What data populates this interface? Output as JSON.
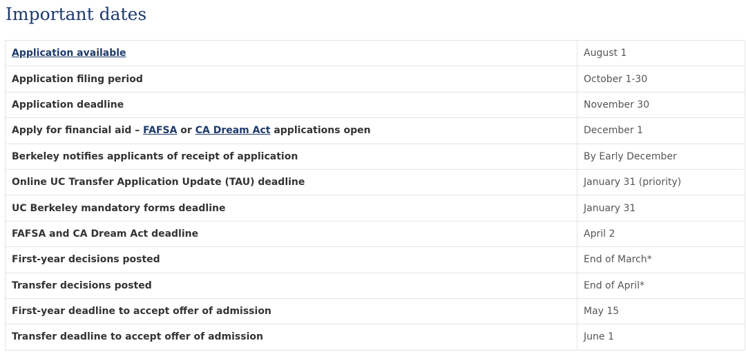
{
  "title": "Important dates",
  "link_color": "#1d3a6b",
  "rows": [
    {
      "parts": [
        {
          "text": "Application available",
          "link": true
        }
      ],
      "date": "August 1"
    },
    {
      "parts": [
        {
          "text": "Application filing period",
          "link": false
        }
      ],
      "date": "October 1-30"
    },
    {
      "parts": [
        {
          "text": "Application deadline",
          "link": false
        }
      ],
      "date": "November 30"
    },
    {
      "parts": [
        {
          "text": "Apply for financial aid – ",
          "link": false
        },
        {
          "text": "FAFSA",
          "link": true
        },
        {
          "text": " or ",
          "link": false
        },
        {
          "text": "CA Dream Act",
          "link": true
        },
        {
          "text": " applications open",
          "link": false
        }
      ],
      "date": "December 1"
    },
    {
      "parts": [
        {
          "text": "Berkeley notifies applicants of receipt of application",
          "link": false
        }
      ],
      "date": "By Early December"
    },
    {
      "parts": [
        {
          "text": "Online UC Transfer Application Update (TAU) deadline",
          "link": false
        }
      ],
      "date": "January 31 (priority)"
    },
    {
      "parts": [
        {
          "text": "UC Berkeley mandatory forms deadline",
          "link": false
        }
      ],
      "date": "January 31"
    },
    {
      "parts": [
        {
          "text": "FAFSA and CA Dream Act deadline",
          "link": false
        }
      ],
      "date": "April 2"
    },
    {
      "parts": [
        {
          "text": "First-year decisions posted",
          "link": false
        }
      ],
      "date": "End of March*"
    },
    {
      "parts": [
        {
          "text": "Transfer decisions posted",
          "link": false
        }
      ],
      "date": "End of April*"
    },
    {
      "parts": [
        {
          "text": "First-year deadline to accept offer of admission",
          "link": false
        }
      ],
      "date": "May 15"
    },
    {
      "parts": [
        {
          "text": "Transfer deadline to accept offer of admission",
          "link": false
        }
      ],
      "date": "June 1"
    }
  ]
}
